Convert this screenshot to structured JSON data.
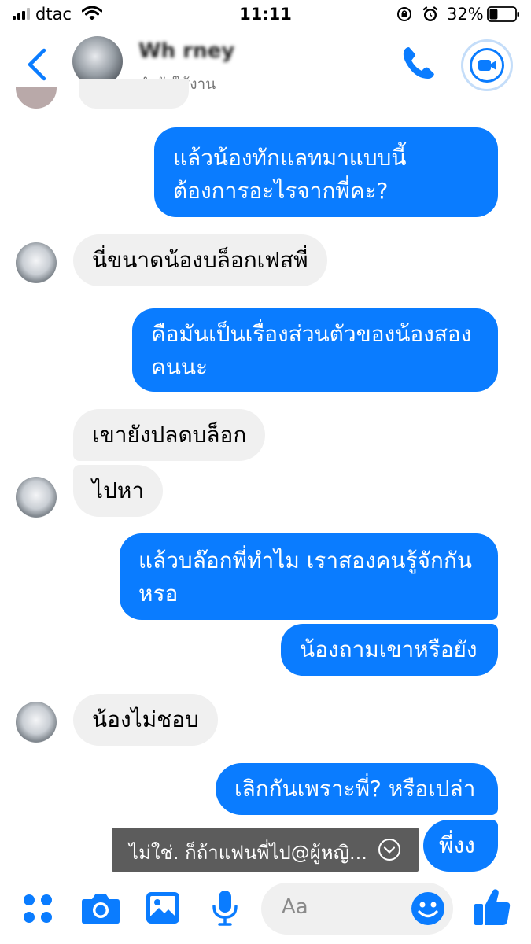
{
  "status_bar": {
    "carrier": "dtac",
    "time": "11:11",
    "battery_percent": "32%",
    "battery_level": 0.32
  },
  "header": {
    "contact_name": "Wh    rney",
    "contact_status": "กำลังใช้งาน"
  },
  "messages": [
    {
      "side": "out",
      "text": "แล้วน้องทักแลทมาแบบนี้\nต้องการอะไรจากพี่คะ?"
    },
    {
      "side": "in",
      "text": "นี่ขนาดน้องบล็อกเฟสพี่"
    },
    {
      "side": "out",
      "text": "คือมันเป็นเรื่องส่วนตัวของน้องสอง\nคนนะ"
    },
    {
      "side": "in",
      "text": "เขายังปลดบล็อก"
    },
    {
      "side": "in",
      "text": "ไปหา"
    },
    {
      "side": "out",
      "text": "แล้วบล๊อกพี่ทำไม เราสองคนรู้จักกัน\nหรอ"
    },
    {
      "side": "out",
      "text": "น้องถามเขาหรือยัง"
    },
    {
      "side": "in",
      "text": "น้องไม่ชอบ"
    },
    {
      "side": "out",
      "text": "เลิกกันเพราะพี่? หรือเปล่า"
    },
    {
      "side": "out",
      "text": "พี่งง"
    }
  ],
  "reply_preview": "ไม่ใช่. ก็ถ้าแฟนพี่ไป@ผู้หญิ...",
  "composer": {
    "placeholder": "Aa"
  },
  "colors": {
    "accent": "#0a7cff",
    "incoming_bubble": "#f0f0f0",
    "reply_bar": "#5c5c5c"
  },
  "icons": [
    "apps-icon",
    "camera-icon",
    "gallery-icon",
    "microphone-icon",
    "emoji-icon",
    "thumbs-up-icon",
    "phone-icon",
    "video-icon",
    "back-chevron-icon"
  ]
}
